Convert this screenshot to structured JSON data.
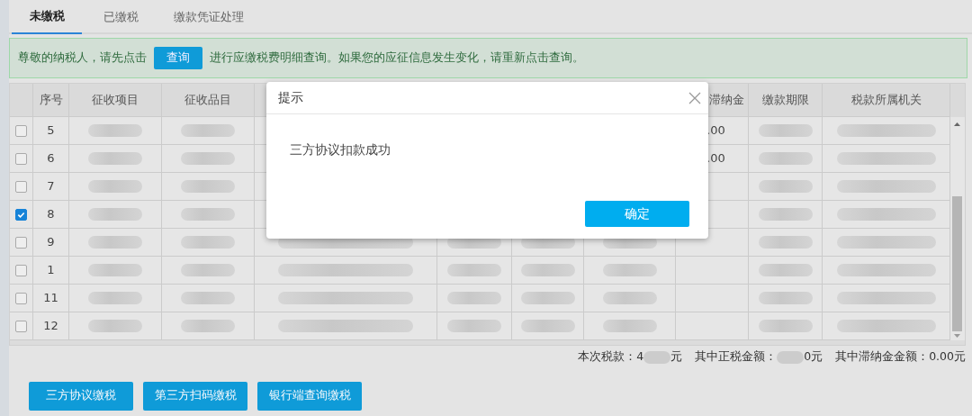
{
  "tabs": [
    {
      "label": "未缴税",
      "selected": true
    },
    {
      "label": "已缴税",
      "selected": false
    },
    {
      "label": "缴款凭证处理",
      "selected": false
    }
  ],
  "notice": {
    "before": "尊敬的纳税人，请先点击",
    "button": "查询",
    "after": "进行应缴税费明细查询。如果您的应征信息发生变化，请重新点击查询。"
  },
  "table": {
    "columns": [
      "序号",
      "征收项目",
      "征收品目",
      "滞纳金",
      "缴款期限",
      "税款所属机关"
    ],
    "rows": [
      {
        "seq": "5",
        "checked": false,
        "late_fee": ".00"
      },
      {
        "seq": "6",
        "checked": false,
        "late_fee": ".00"
      },
      {
        "seq": "7",
        "checked": false
      },
      {
        "seq": "8",
        "checked": true
      },
      {
        "seq": "9",
        "checked": false
      },
      {
        "seq": "1",
        "checked": false
      },
      {
        "seq": "11",
        "checked": false
      },
      {
        "seq": "12",
        "checked": false
      }
    ]
  },
  "summary": [
    {
      "label": "本次税款：",
      "value_start": "4",
      "value_end": "元"
    },
    {
      "label": "其中正税金额：",
      "value_end": "0元"
    },
    {
      "label": "其中滞纳金金额：",
      "value_start": "0.00元"
    }
  ],
  "actions": [
    "三方协议缴税",
    "第三方扫码缴税",
    "银行端查询缴税"
  ],
  "dialog": {
    "title": "提示",
    "message": "三方协议扣款成功",
    "confirm": "确定"
  }
}
